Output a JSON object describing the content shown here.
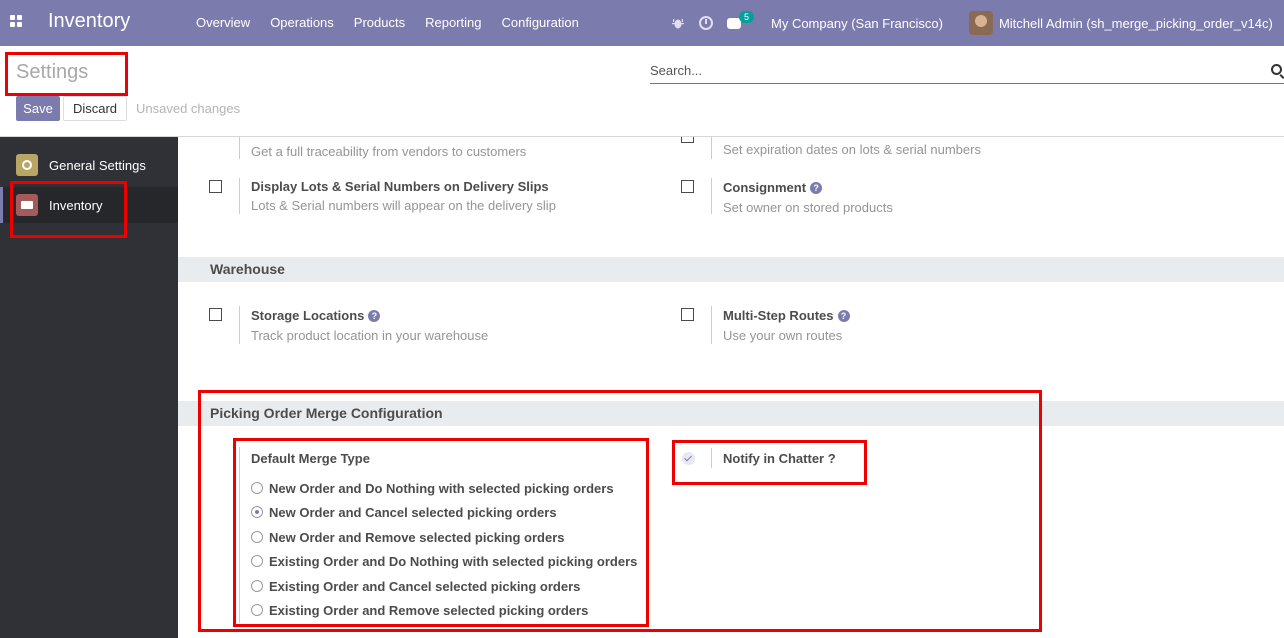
{
  "navbar": {
    "app_name": "Inventory",
    "menu": [
      "Overview",
      "Operations",
      "Products",
      "Reporting",
      "Configuration"
    ],
    "messages_count": "5",
    "company": "My Company (San Francisco)",
    "user": "Mitchell Admin (sh_merge_picking_order_v14c)"
  },
  "control": {
    "title": "Settings",
    "search_placeholder": "Search...",
    "save_label": "Save",
    "discard_label": "Discard",
    "status": "Unsaved changes"
  },
  "sidebar": {
    "items": [
      {
        "label": "General Settings",
        "icon": "gear-icon"
      },
      {
        "label": "Inventory",
        "icon": "inventory-icon"
      }
    ]
  },
  "settings": {
    "lots_desc": "Get a full traceability from vendors to customers",
    "expiration_desc": "Set expiration dates on lots & serial numbers",
    "display_lots_label": "Display Lots & Serial Numbers on Delivery Slips",
    "display_lots_desc": "Lots & Serial numbers will appear on the delivery slip",
    "consignment_label": "Consignment",
    "consignment_desc": "Set owner on stored products",
    "warehouse_section": "Warehouse",
    "storage_label": "Storage Locations",
    "storage_desc": "Track product location in your warehouse",
    "multistep_label": "Multi-Step Routes",
    "multistep_desc": "Use your own routes",
    "merge_section": "Picking Order Merge Configuration",
    "merge_type_label": "Default Merge Type",
    "merge_options": [
      "New Order and Do Nothing with selected picking orders",
      "New Order and Cancel selected picking orders",
      "New Order and Remove selected picking orders",
      "Existing Order and Do Nothing with selected picking orders",
      "Existing Order and Cancel selected picking orders",
      "Existing Order and Remove selected picking orders"
    ],
    "merge_selected": "New Order and Cancel selected picking orders",
    "notify_label": "Notify in Chatter ?",
    "notify_checked": true
  },
  "colors": {
    "brand": "#7c7bad",
    "highlight": "#ee0000"
  }
}
